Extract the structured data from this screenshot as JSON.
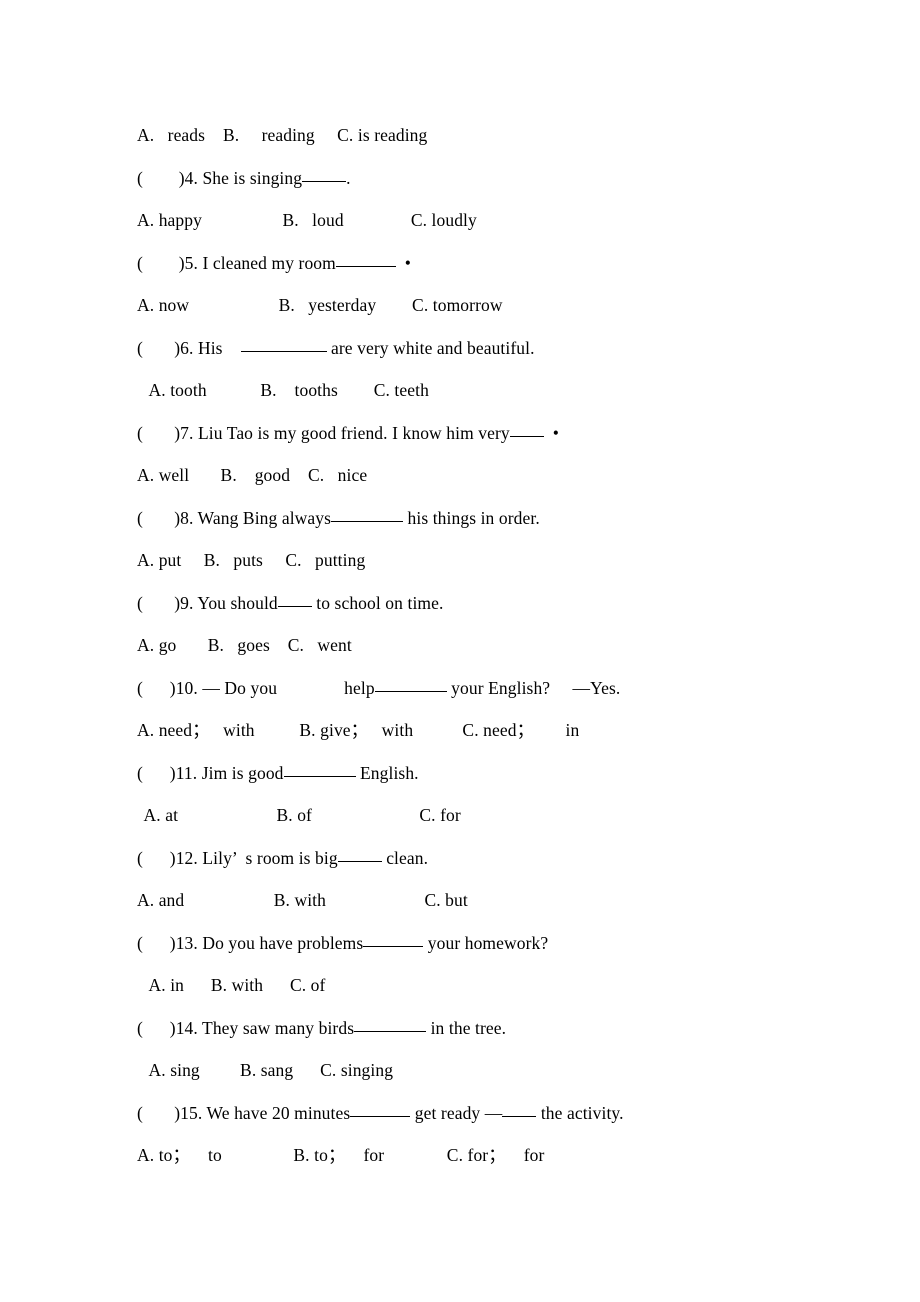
{
  "document": {
    "type": "english-grammar-worksheet",
    "background_color": "#ffffff",
    "text_color": "#000000"
  },
  "questions": [
    {
      "id": "q3-options",
      "kind": "options-only",
      "text": "A.   reads    B.     reading     C. is reading"
    },
    {
      "id": "q4",
      "kind": "question",
      "number": "4",
      "prefix": "(        )4. ",
      "before_blank": "She is singing",
      "blank_size": "b-sm",
      "after_blank": "."
    },
    {
      "id": "q4-options",
      "kind": "options-only",
      "text": "A. happy                  B.   loud               C. loudly"
    },
    {
      "id": "q5",
      "kind": "question",
      "number": "5",
      "prefix": "(        )5. ",
      "before_blank": "I cleaned my room",
      "blank_size": "b-md",
      "after_blank": "  •"
    },
    {
      "id": "q5-options",
      "kind": "options-only",
      "text": "A. now                    B.   yesterday        C. tomorrow"
    },
    {
      "id": "q6",
      "kind": "question",
      "number": "6",
      "prefix": "(       )6. ",
      "before_blank": "His    ",
      "blank_size": "b-xl",
      "after_blank": " are very white and beautiful."
    },
    {
      "id": "q6-options",
      "kind": "options-only",
      "text": " A. tooth            B.    tooths        C. teeth"
    },
    {
      "id": "q7",
      "kind": "question",
      "number": "7",
      "prefix": "(       )7. ",
      "before_blank": "Liu Tao is my good friend. I know him very",
      "blank_size": "b-xs",
      "after_blank": "  •"
    },
    {
      "id": "q7-options",
      "kind": "options-only",
      "text": "A. well       B.    good    C.   nice"
    },
    {
      "id": "q8",
      "kind": "question",
      "number": "8",
      "prefix": "(       )8. ",
      "before_blank": "Wang Bing always",
      "blank_size": "b-lg",
      "after_blank": " his things in order."
    },
    {
      "id": "q8-options",
      "kind": "options-only",
      "text": "A. put     B.   puts     C.   putting"
    },
    {
      "id": "q9",
      "kind": "question",
      "number": "9",
      "prefix": "(       )9. ",
      "before_blank": "You should",
      "blank_size": "b-xs",
      "after_blank": " to school on time."
    },
    {
      "id": "q9-options",
      "kind": "options-only",
      "text": "A. go       B.   goes    C.   went"
    },
    {
      "id": "q10",
      "kind": "question",
      "number": "10",
      "prefix": "(      )10. ",
      "before_blank": "— Do you               help",
      "blank_size": "b-lg",
      "after_blank": " your English?     —Yes."
    },
    {
      "id": "q10-options",
      "kind": "options-only",
      "text": "A. need；   with          B. give；   with           C. need；       in"
    },
    {
      "id": "q11",
      "kind": "question",
      "number": "11",
      "prefix": "(      )11. ",
      "before_blank": "Jim is good",
      "blank_size": "b-lg",
      "after_blank": " English."
    },
    {
      "id": "q11-options",
      "kind": "options-only",
      "text": " A. at                      B. of                        C. for"
    },
    {
      "id": "q12",
      "kind": "question",
      "number": "12",
      "prefix": "(      )12. ",
      "before_blank": "Lily’  s room is big",
      "blank_size": "b-sm",
      "after_blank": " clean."
    },
    {
      "id": "q12-options",
      "kind": "options-only",
      "text": "A. and                    B. with                      C. but"
    },
    {
      "id": "q13",
      "kind": "question",
      "number": "13",
      "prefix": "(      )13. ",
      "before_blank": "Do you have problems",
      "blank_size": "b-md",
      "after_blank": " your homework?"
    },
    {
      "id": "q13-options",
      "kind": "options-only",
      "text": " A. in      B. with      C. of"
    },
    {
      "id": "q14",
      "kind": "question",
      "number": "14",
      "prefix": "(      )14. ",
      "before_blank": "They saw many birds",
      "blank_size": "b-lg",
      "after_blank": " in the tree."
    },
    {
      "id": "q14-options",
      "kind": "options-only",
      "text": " A. sing         B. sang      C. singing"
    },
    {
      "id": "q15",
      "kind": "question",
      "number": "15",
      "prefix": "(       )15. ",
      "before_blank": "We have 20 minutes",
      "blank_size": "b-md",
      "after_blank": " get ready —",
      "blank2_size": "b-xs",
      "after_blank2": " the activity."
    },
    {
      "id": "q15-options",
      "kind": "options-only",
      "text": "A. to；    to                B. to；    for              C. for；    for"
    }
  ]
}
